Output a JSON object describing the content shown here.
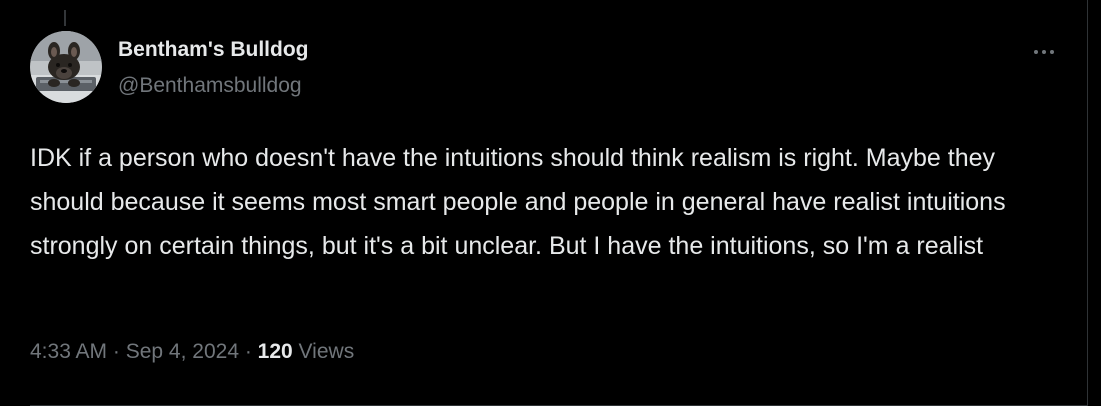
{
  "author": {
    "name": "Bentham's Bulldog",
    "handle": "@Benthamsbulldog"
  },
  "more_icon": "more-horizontal-icon",
  "tweet": {
    "text": "IDK if a person who doesn't have the intuitions should think realism is right. Maybe they should because it seems most smart people and people in general have realist intuitions strongly on certain things, but it's a bit unclear. But I have the intuitions, so I'm a realist"
  },
  "meta": {
    "time": "4:33 AM",
    "separator": " · ",
    "date": "Sep 4, 2024",
    "views_count": "120",
    "views_label": " Views"
  },
  "colors": {
    "background": "#000000",
    "text_primary": "#e7e9ea",
    "text_secondary": "#71767b",
    "border": "#2f3336"
  }
}
